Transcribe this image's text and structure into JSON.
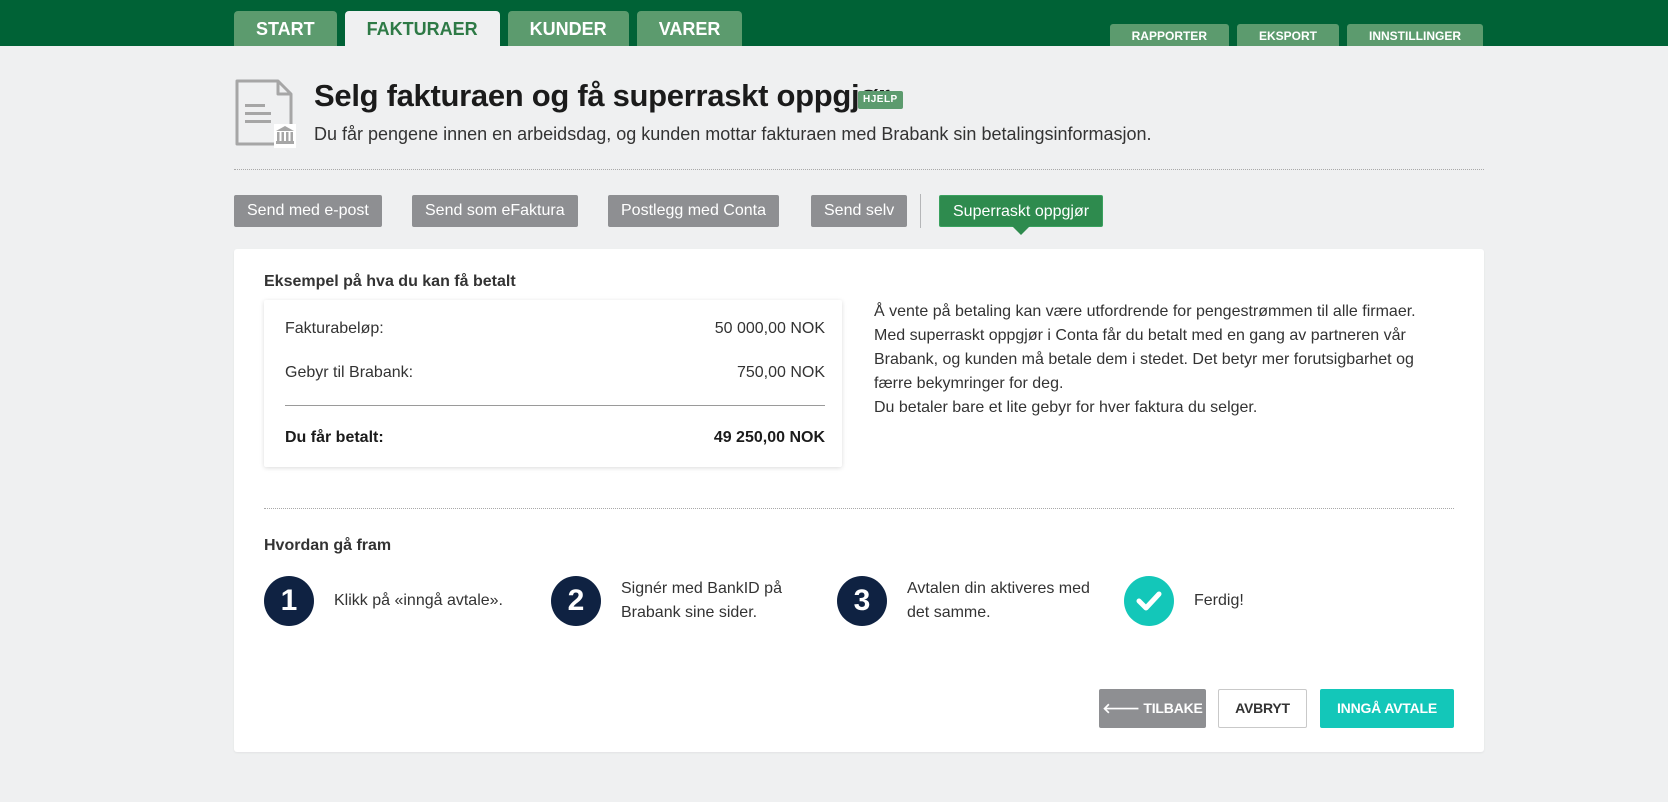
{
  "nav": {
    "main_tabs": [
      {
        "label": "START"
      },
      {
        "label": "FAKTURAER"
      },
      {
        "label": "KUNDER"
      },
      {
        "label": "VARER"
      }
    ],
    "sub_tabs": [
      {
        "label": "RAPPORTER"
      },
      {
        "label": "EKSPORT"
      },
      {
        "label": "INNSTILLINGER"
      }
    ]
  },
  "header": {
    "title": "Selg fakturaen og få superraskt oppgjør",
    "help_label": "HJELP",
    "subtitle": "Du får pengene innen en arbeidsdag, og kunden mottar fakturaen med Brabank sin betalingsinformasjon.",
    "icon": "invoice-bank-icon"
  },
  "methods": [
    {
      "label": "Send med e-post"
    },
    {
      "label": "Send som eFaktura"
    },
    {
      "label": "Postlegg med Conta"
    },
    {
      "label": "Send selv"
    },
    {
      "label": "Superraskt oppgjør",
      "active": true
    }
  ],
  "example": {
    "title": "Eksempel på hva du kan få betalt",
    "invoice_label": "Fakturabeløp:",
    "invoice_value": "50 000,00 NOK",
    "fee_label": "Gebyr til Brabank:",
    "fee_value": "750,00 NOK",
    "total_label": "Du får betalt:",
    "total_value": "49 250,00 NOK"
  },
  "info": {
    "line1": "Å vente på betaling kan være utfordrende for pengestrømmen til alle firmaer.",
    "line2": "Med superraskt oppgjør i Conta får du betalt med en gang av partneren vår Brabank, og kunden må betale dem i stedet. Det betyr mer forutsigbarhet og færre bekymringer for deg.",
    "line3": "Du betaler bare et lite gebyr for hver faktura du selger."
  },
  "steps": {
    "title": "Hvordan gå fram",
    "items": [
      {
        "number": "1",
        "text": "Klikk på «inngå avtale»."
      },
      {
        "number": "2",
        "text": "Signér med BankID på Brabank sine sider."
      },
      {
        "number": "3",
        "text": "Avtalen din aktiveres med det samme."
      },
      {
        "icon": "checkmark-icon",
        "text": "Ferdig!"
      }
    ]
  },
  "actions": {
    "back_label": "TILBAKE",
    "cancel_label": "AVBRYT",
    "accept_label": "INNGÅ AVTALE"
  },
  "colors": {
    "brand_green": "#006236",
    "tab_green": "#5c9b6e",
    "active_method": "#2e8b4e",
    "step_dark": "#0f2242",
    "accent_teal": "#13c7b9"
  }
}
